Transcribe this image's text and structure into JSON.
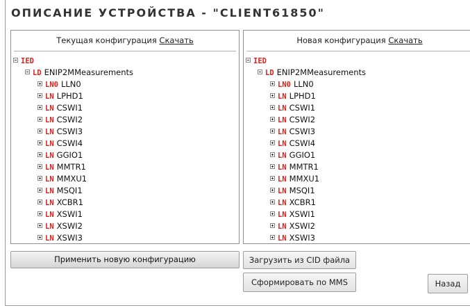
{
  "title": "ОПИСАНИЕ УСТРОЙСТВА - \"CLIENT61850\"",
  "left_panel": {
    "header_text": "Текущая конфигурация",
    "download_link": "Скачать",
    "tree": {
      "root_tag": "IED",
      "device_tag": "LD",
      "device_name": "ENIP2MMeasurements",
      "nodes": [
        {
          "tag": "LN0",
          "name": "LLN0"
        },
        {
          "tag": "LN",
          "name": "LPHD1"
        },
        {
          "tag": "LN",
          "name": "CSWI1"
        },
        {
          "tag": "LN",
          "name": "CSWI2"
        },
        {
          "tag": "LN",
          "name": "CSWI3"
        },
        {
          "tag": "LN",
          "name": "CSWI4"
        },
        {
          "tag": "LN",
          "name": "GGIO1"
        },
        {
          "tag": "LN",
          "name": "MMTR1"
        },
        {
          "tag": "LN",
          "name": "MMXU1"
        },
        {
          "tag": "LN",
          "name": "MSQI1"
        },
        {
          "tag": "LN",
          "name": "XCBR1"
        },
        {
          "tag": "LN",
          "name": "XSWI1"
        },
        {
          "tag": "LN",
          "name": "XSWI2"
        },
        {
          "tag": "LN",
          "name": "XSWI3"
        }
      ]
    }
  },
  "right_panel": {
    "header_text": "Новая конфигурация",
    "download_link": "Скачать",
    "tree": {
      "root_tag": "IED",
      "device_tag": "LD",
      "device_name": "ENIP2MMeasurements",
      "nodes": [
        {
          "tag": "LN0",
          "name": "LLN0"
        },
        {
          "tag": "LN",
          "name": "LPHD1"
        },
        {
          "tag": "LN",
          "name": "CSWI1"
        },
        {
          "tag": "LN",
          "name": "CSWI2"
        },
        {
          "tag": "LN",
          "name": "CSWI3"
        },
        {
          "tag": "LN",
          "name": "CSWI4"
        },
        {
          "tag": "LN",
          "name": "GGIO1"
        },
        {
          "tag": "LN",
          "name": "MMTR1"
        },
        {
          "tag": "LN",
          "name": "MMXU1"
        },
        {
          "tag": "LN",
          "name": "MSQI1"
        },
        {
          "tag": "LN",
          "name": "XCBR1"
        },
        {
          "tag": "LN",
          "name": "XSWI1"
        },
        {
          "tag": "LN",
          "name": "XSWI2"
        },
        {
          "tag": "LN",
          "name": "XSWI3"
        }
      ]
    }
  },
  "buttons": {
    "apply": "Применить новую конфигурацию",
    "load_cid": "Загрузить из CID файла",
    "build_mms": "Сформировать по MMS",
    "back": "Назад"
  }
}
